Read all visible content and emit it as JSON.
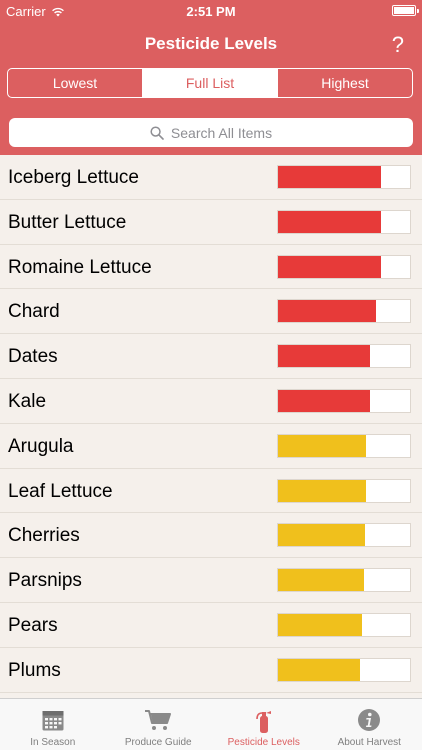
{
  "status": {
    "carrier": "Carrier",
    "time": "2:51 PM"
  },
  "nav": {
    "title": "Pesticide Levels",
    "help": "?"
  },
  "segments": [
    {
      "label": "Lowest",
      "active": false
    },
    {
      "label": "Full List",
      "active": true
    },
    {
      "label": "Highest",
      "active": false
    }
  ],
  "search": {
    "placeholder": "Search All Items"
  },
  "colors": {
    "header": "#dc5f60",
    "high": "#e73a39",
    "medium": "#f0c01c"
  },
  "items": [
    {
      "name": "Iceberg Lettuce",
      "level": 0.78,
      "color": "high"
    },
    {
      "name": "Butter Lettuce",
      "level": 0.78,
      "color": "high"
    },
    {
      "name": "Romaine Lettuce",
      "level": 0.78,
      "color": "high"
    },
    {
      "name": "Chard",
      "level": 0.74,
      "color": "high"
    },
    {
      "name": "Dates",
      "level": 0.7,
      "color": "high"
    },
    {
      "name": "Kale",
      "level": 0.7,
      "color": "high"
    },
    {
      "name": "Arugula",
      "level": 0.67,
      "color": "medium"
    },
    {
      "name": "Leaf Lettuce",
      "level": 0.67,
      "color": "medium"
    },
    {
      "name": "Cherries",
      "level": 0.66,
      "color": "medium"
    },
    {
      "name": "Parsnips",
      "level": 0.65,
      "color": "medium"
    },
    {
      "name": "Pears",
      "level": 0.64,
      "color": "medium"
    },
    {
      "name": "Plums",
      "level": 0.62,
      "color": "medium"
    }
  ],
  "tabs": [
    {
      "label": "In Season",
      "icon": "calendar-icon",
      "active": false
    },
    {
      "label": "Produce Guide",
      "icon": "cart-icon",
      "active": false
    },
    {
      "label": "Pesticide Levels",
      "icon": "extinguisher-icon",
      "active": true
    },
    {
      "label": "About Harvest",
      "icon": "info-icon",
      "active": false
    }
  ]
}
